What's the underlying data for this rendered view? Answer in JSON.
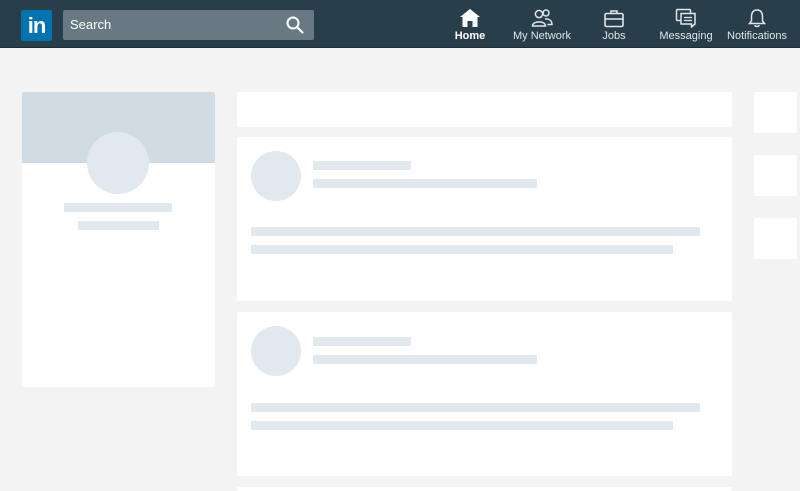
{
  "header": {
    "logo_text": "in",
    "search": {
      "placeholder": "Search"
    },
    "nav": [
      {
        "label": "Home",
        "icon": "home-icon",
        "active": true
      },
      {
        "label": "My Network",
        "icon": "people-icon"
      },
      {
        "label": "Jobs",
        "icon": "briefcase-icon"
      },
      {
        "label": "Messaging",
        "icon": "chat-icon"
      },
      {
        "label": "Notifications",
        "icon": "bell-icon"
      }
    ]
  },
  "colors": {
    "header_bg": "#283e4a",
    "brand_blue": "#0073b1",
    "page_bg": "#f3f3f3",
    "skeleton": "#e1e8ee",
    "profile_banner": "#d0dbe3"
  }
}
